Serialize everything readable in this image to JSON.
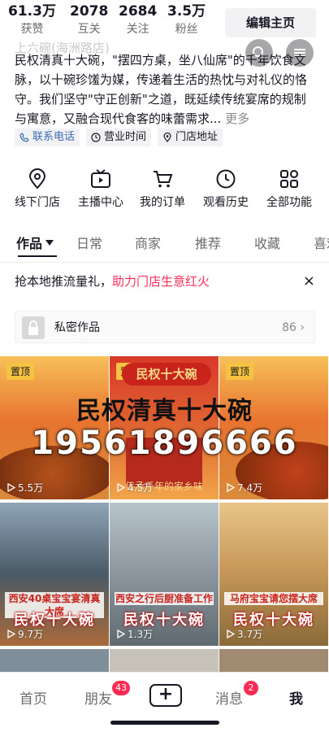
{
  "stats": [
    {
      "num": "61.3万",
      "label": "获赞"
    },
    {
      "num": "2078",
      "label": "互关"
    },
    {
      "num": "2684",
      "label": "关注"
    },
    {
      "num": "3.5万",
      "label": "粉丝"
    }
  ],
  "header": {
    "edit_button": "编辑主页",
    "overlay_title": "上六碗(海洲路店)"
  },
  "bio": {
    "text": "民权清真十大碗，\"摆四方桌，坐八仙席\"的千年饮食文脉，以十碗珍馐为媒，传递着生活的热忱与对礼仪的恪守。我们坚守\"守正创新\"之道，既延续传统宴席的规制与寓意，又融合现代食客的味蕾需求...",
    "more": "更多"
  },
  "chips": [
    {
      "icon": "phone-icon",
      "label": "联系电话"
    },
    {
      "icon": "clock-icon",
      "label": "营业时间"
    },
    {
      "icon": "location-icon",
      "label": "门店地址"
    }
  ],
  "functions": [
    {
      "icon": "location-pin-icon",
      "label": "线下门店"
    },
    {
      "icon": "tv-icon",
      "label": "主播中心"
    },
    {
      "icon": "cart-icon",
      "label": "我的订单"
    },
    {
      "icon": "clock-icon",
      "label": "观看历史"
    },
    {
      "icon": "grid-icon",
      "label": "全部功能"
    }
  ],
  "tabs": [
    "作品",
    "日常",
    "商家",
    "推荐",
    "收藏",
    "喜欢"
  ],
  "promo": {
    "text": "抢本地推流量礼，",
    "highlight": "助力门店生意红火",
    "close": "×"
  },
  "private_works": {
    "label": "私密作品",
    "count": "86"
  },
  "banner": {
    "title": "民权清真十大碗",
    "phone": "19561896666",
    "strip": "民权十大碗",
    "sub": "传承千年的家乡味"
  },
  "videos": [
    {
      "pinned": "置顶",
      "plays": "5.5万"
    },
    {
      "pinned": "置顶",
      "plays": "4.5万"
    },
    {
      "pinned": "置顶",
      "plays": "7.4万"
    },
    {
      "caption": "西安40桌宝宝宴清真大席",
      "brand": "民权十大碗",
      "plays": "9.7万"
    },
    {
      "caption": "西安之行后厨准备工作",
      "brand": "民权十大碗",
      "plays": "1.3万"
    },
    {
      "caption": "马府宝宝请您摆大席",
      "brand": "民权十大碗",
      "plays": "3.7万"
    }
  ],
  "bottom_nav": {
    "home": "首页",
    "friends": "朋友",
    "friends_badge": "43",
    "plus": "+",
    "messages": "消息",
    "messages_badge": "2",
    "me": "我"
  },
  "colors": {
    "accent": "#fe2c55",
    "pin": "#f6c341",
    "banner_red": "#c8241b"
  }
}
